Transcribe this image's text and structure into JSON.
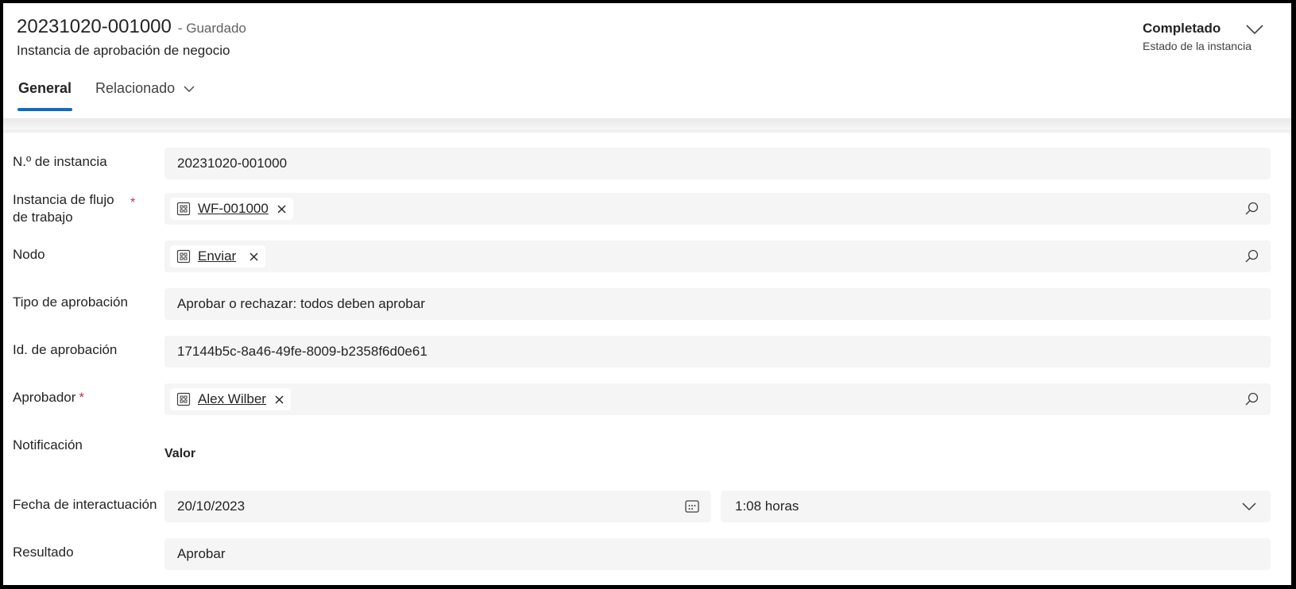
{
  "header": {
    "title": "20231020-001000",
    "saved_status": "- Guardado",
    "subtitle": "Instancia de aprobación de negocio",
    "status_value": "Completado",
    "status_label": "Estado de la instancia",
    "tabs": [
      {
        "label": "General",
        "active": true
      },
      {
        "label": "Relacionado",
        "active": false
      }
    ]
  },
  "form": {
    "instance_number": {
      "label": "N.º de instancia",
      "value": "20231020-001000"
    },
    "workflow_instance": {
      "label_line1": "Instancia de flujo",
      "label_line2": "de trabajo",
      "required": "*",
      "value": "WF-001000"
    },
    "node": {
      "label": "Nodo",
      "value": "Enviar"
    },
    "approval_type": {
      "label": "Tipo de aprobación",
      "value": "Aprobar o rechazar: todos deben aprobar"
    },
    "approval_id": {
      "label": "Id. de aprobación",
      "value": "17144b5c-8a46-49fe-8009-b2358f6d0e61"
    },
    "approver": {
      "label": "Aprobador",
      "required": "*",
      "value": "Alex Wilber"
    },
    "notification": {
      "label": "Notificación",
      "value_header": "Valor"
    },
    "interaction_date": {
      "label": "Fecha de interactuación",
      "date": "20/10/2023",
      "time": "1:08 horas"
    },
    "result": {
      "label": "Resultado",
      "value": "Aprobar"
    }
  },
  "icons": {
    "status_dropdown": "chevron-down-icon",
    "lookup_entity": "entity-icon",
    "remove": "close-icon",
    "lookup_search": "search-icon",
    "calendar": "calendar-icon"
  },
  "colors": {
    "accent": "#0f6cbd",
    "required": "#c4314b",
    "field_bg": "#f5f5f5"
  }
}
